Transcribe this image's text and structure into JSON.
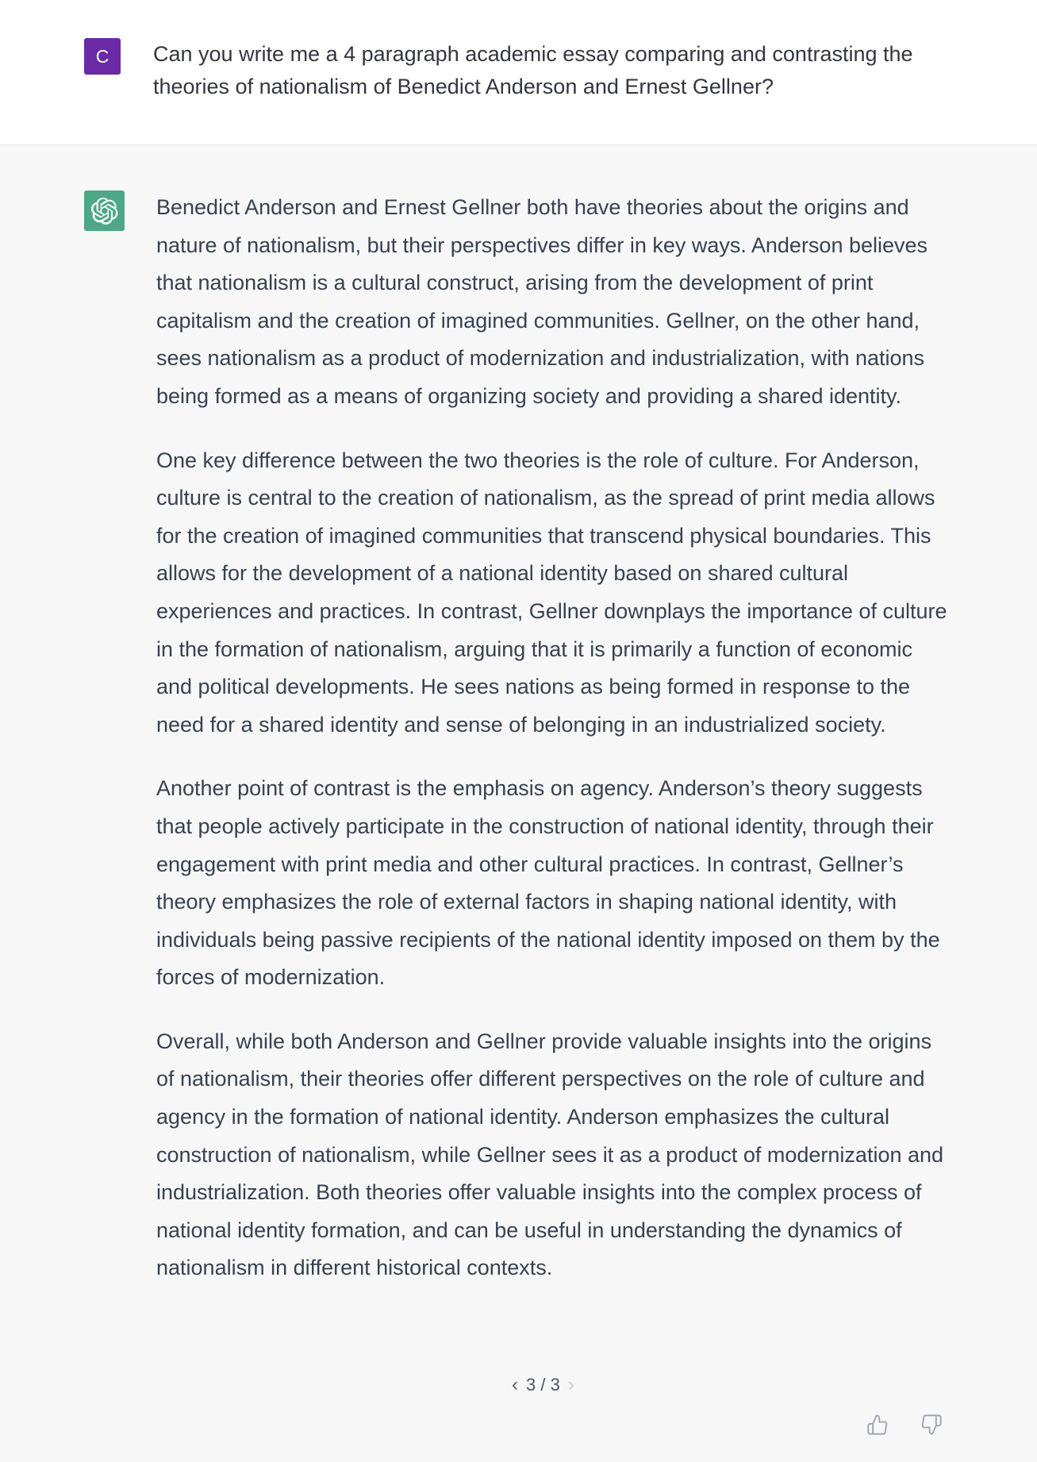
{
  "user": {
    "avatar_initial": "C",
    "avatar_color": "#6b2aa5",
    "message": "Can you write me a 4 paragraph academic essay comparing and contrasting the theories of nationalism of Benedict Anderson and Ernest Gellner?"
  },
  "assistant": {
    "avatar_icon": "openai-logo-icon",
    "avatar_color": "#4ea888",
    "paragraphs": [
      "Benedict Anderson and Ernest Gellner both have theories about the origins and nature of nationalism, but their perspectives differ in key ways. Anderson believes that nationalism is a cultural construct, arising from the development of print capitalism and the creation of imagined communities. Gellner, on the other hand, sees nationalism as a product of modernization and industrialization, with nations being formed as a means of organizing society and providing a shared identity.",
      "One key difference between the two theories is the role of culture. For Anderson, culture is central to the creation of nationalism, as the spread of print media allows for the creation of imagined communities that transcend physical boundaries. This allows for the development of a national identity based on shared cultural experiences and practices. In contrast, Gellner downplays the importance of culture in the formation of nationalism, arguing that it is primarily a function of economic and political developments. He sees nations as being formed in response to the need for a shared identity and sense of belonging in an industrialized society.",
      "Another point of contrast is the emphasis on agency. Anderson’s theory suggests that people actively participate in the construction of national identity, through their engagement with print media and other cultural practices. In contrast, Gellner’s theory emphasizes the role of external factors in shaping national identity, with individuals being passive recipients of the national identity imposed on them by the forces of modernization.",
      "Overall, while both Anderson and Gellner provide valuable insights into the origins of nationalism, their theories offer different perspectives on the role of culture and agency in the formation of national identity. Anderson emphasizes the cultural construction of nationalism, while Gellner sees it as a product of modernization and industrialization. Both theories offer valuable insights into the complex process of national identity formation, and can be useful in understanding the dynamics of nationalism in different historical contexts."
    ],
    "pager": {
      "prev": "‹",
      "label": "3 / 3",
      "next": "›"
    },
    "feedback": {
      "thumbs_up_icon": "thumbs-up-icon",
      "thumbs_down_icon": "thumbs-down-icon"
    }
  },
  "colors": {
    "user_bg": "#ffffff",
    "assistant_bg": "#f7f7f8",
    "text": "#374151"
  }
}
